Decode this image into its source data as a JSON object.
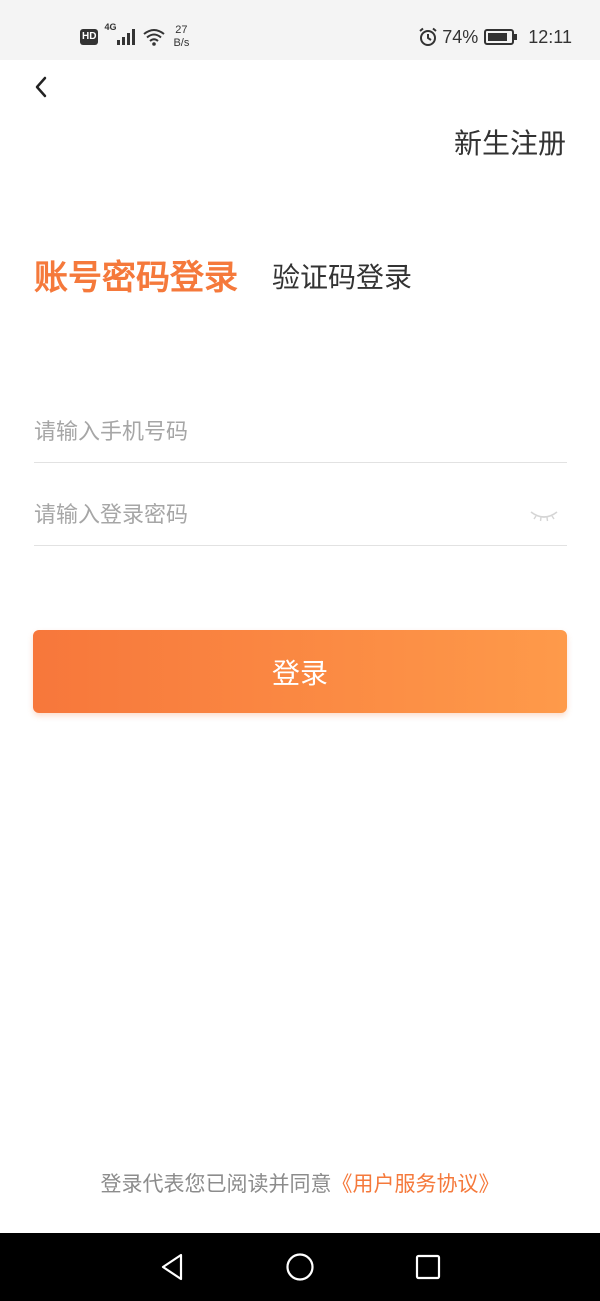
{
  "status_bar": {
    "hd": "HD",
    "network": "4G",
    "speed_value": "27",
    "speed_unit": "B/s",
    "battery": "74%",
    "time": "12:11"
  },
  "header": {
    "register_label": "新生注册"
  },
  "tabs": {
    "active_label": "账号密码登录",
    "inactive_label": "验证码登录"
  },
  "form": {
    "phone_placeholder": "请输入手机号码",
    "password_placeholder": "请输入登录密码",
    "login_label": "登录"
  },
  "agreement": {
    "text": "登录代表您已阅读并同意",
    "link_label": "《用户服务协议》"
  },
  "colors": {
    "accent": "#f5793b",
    "button_gradient_start": "#f7773b",
    "button_gradient_end": "#fe9a4a"
  },
  "icons": [
    "back-chevron-icon",
    "eye-closed-icon",
    "signal-icon",
    "wifi-icon",
    "alarm-icon",
    "battery-icon",
    "nav-back-icon",
    "nav-home-icon",
    "nav-recents-icon"
  ]
}
